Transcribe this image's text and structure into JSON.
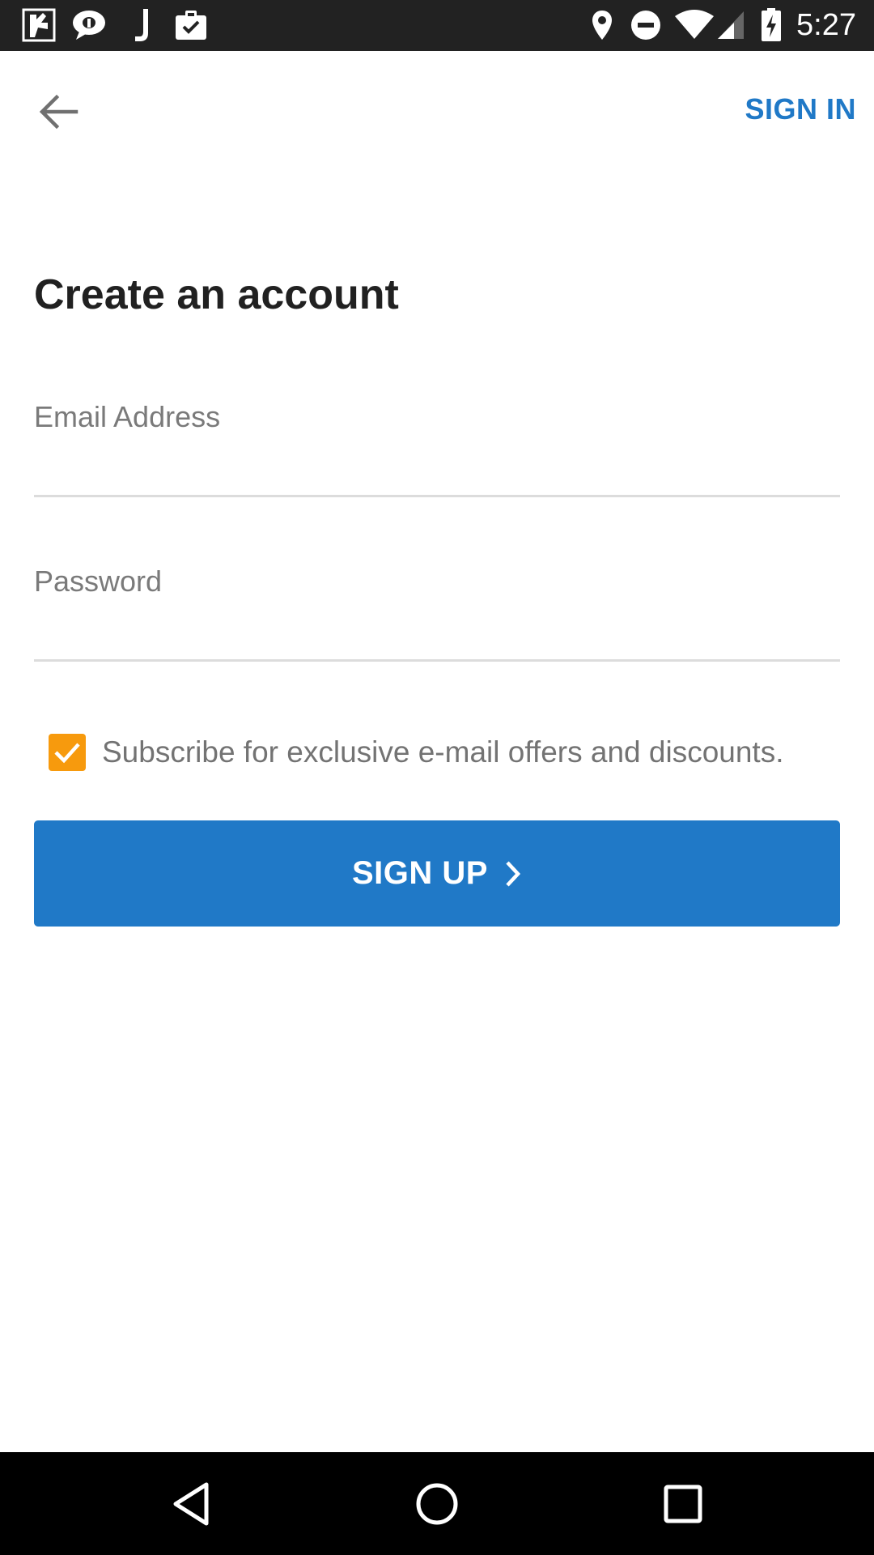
{
  "status_bar": {
    "time": "5:27",
    "left_icons": [
      "nyt-app-icon",
      "speech-bubble-icon",
      "j-app-icon",
      "clipboard-check-icon"
    ],
    "right_icons": [
      "location-pin-icon",
      "do-not-disturb-icon",
      "wifi-icon",
      "cell-signal-icon",
      "battery-charging-icon"
    ]
  },
  "app_bar": {
    "back_icon": "arrow-back-icon",
    "sign_in_label": "SIGN IN"
  },
  "form": {
    "title": "Create an account",
    "email": {
      "placeholder": "Email Address",
      "value": ""
    },
    "password": {
      "placeholder": "Password",
      "value": ""
    },
    "subscribe": {
      "label": "Subscribe for exclusive e-mail offers and discounts.",
      "checked": true
    },
    "signup_label": "SIGN UP",
    "signup_icon": "chevron-right-icon"
  },
  "nav_bar": {
    "buttons": [
      "back-triangle-icon",
      "home-circle-icon",
      "recents-square-icon"
    ]
  },
  "colors": {
    "accent": "#2079c7",
    "checkbox": "#f79a0d",
    "status_bar": "#222222",
    "nav_bar": "#000000",
    "title_text": "#212121",
    "hint_text": "#7a7a7a",
    "divider": "#dcdcdc"
  }
}
